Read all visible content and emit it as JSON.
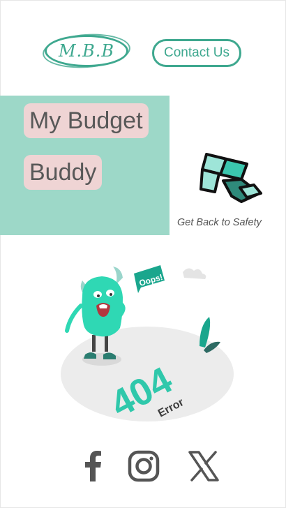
{
  "header": {
    "logo_text": "M.B.B",
    "contact_label": "Contact Us"
  },
  "hero": {
    "title_line1": "My Budget",
    "title_line2": "Buddy"
  },
  "safety": {
    "label": "Get Back to Safety",
    "icon": "logo-blocks-icon"
  },
  "error_illustration": {
    "speech": "Oops!",
    "code": "404",
    "word": "Error"
  },
  "social": {
    "items": [
      {
        "icon": "facebook-icon"
      },
      {
        "icon": "instagram-icon"
      },
      {
        "icon": "x-twitter-icon"
      }
    ]
  },
  "colors": {
    "accent": "#3ea88f",
    "panel": "#9dd8c8",
    "chip": "#efd4d4",
    "icon_dark": "#555555"
  }
}
